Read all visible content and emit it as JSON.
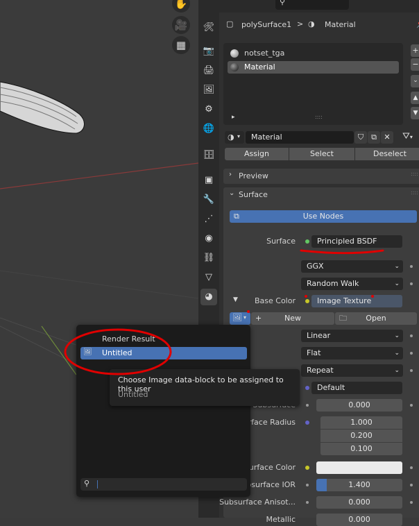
{
  "viewport_tools": {
    "pan": "hand-icon",
    "camera": "camera-icon",
    "grid": "grid-icon"
  },
  "header": {
    "object_name": "polySurface1",
    "separator": ">",
    "material_name": "Material"
  },
  "material_slots": [
    {
      "name": "notset_tga",
      "selected": false
    },
    {
      "name": "Material",
      "selected": true
    }
  ],
  "slot_footer": {
    "expand": "▸",
    "grip": "::::"
  },
  "datablock": {
    "name": "Material"
  },
  "slot_actions": {
    "assign": "Assign",
    "select": "Select",
    "deselect": "Deselect"
  },
  "panels": {
    "preview": "Preview",
    "surface": "Surface"
  },
  "use_nodes": "Use Nodes",
  "surface": {
    "surface_label": "Surface",
    "surface_value": "Principled BSDF",
    "distribution": "GGX",
    "subsurface_method": "Random Walk",
    "base_color_label": "Base Color",
    "base_color_value": "Image Texture",
    "new_label": "New",
    "open_label": "Open",
    "interpolation": "Linear",
    "projection": "Flat",
    "extension": "Repeat",
    "vector": "Default",
    "subsurface_label": "Subsurface",
    "subsurface_value": "0.000",
    "subsurface_radius_label": "Subsurface Radius",
    "radius": [
      "1.000",
      "0.200",
      "0.100"
    ],
    "subsurface_color_label": "Subsurface Color",
    "subsurface_ior_label": "Subsurface IOR",
    "subsurface_ior_value": "1.400",
    "subsurface_aniso_label": "Subsurface Anisot...",
    "subsurface_aniso_value": "0.000",
    "metallic_label": "Metallic",
    "metallic_value": "0.000"
  },
  "image_popup": {
    "items": [
      {
        "label": "Render Result",
        "selected": false
      },
      {
        "label": "Untitled",
        "selected": true
      }
    ],
    "search_placeholder": ""
  },
  "tooltip": {
    "title": "Choose Image data-block to be assigned to this user",
    "subtitle": "Untitled"
  },
  "colors": {
    "accent_blue": "#4772b3",
    "annotation_red": "#e00000",
    "socket_green": "#63c763",
    "socket_yellow": "#c7c729",
    "socket_purple": "#6363c7"
  }
}
